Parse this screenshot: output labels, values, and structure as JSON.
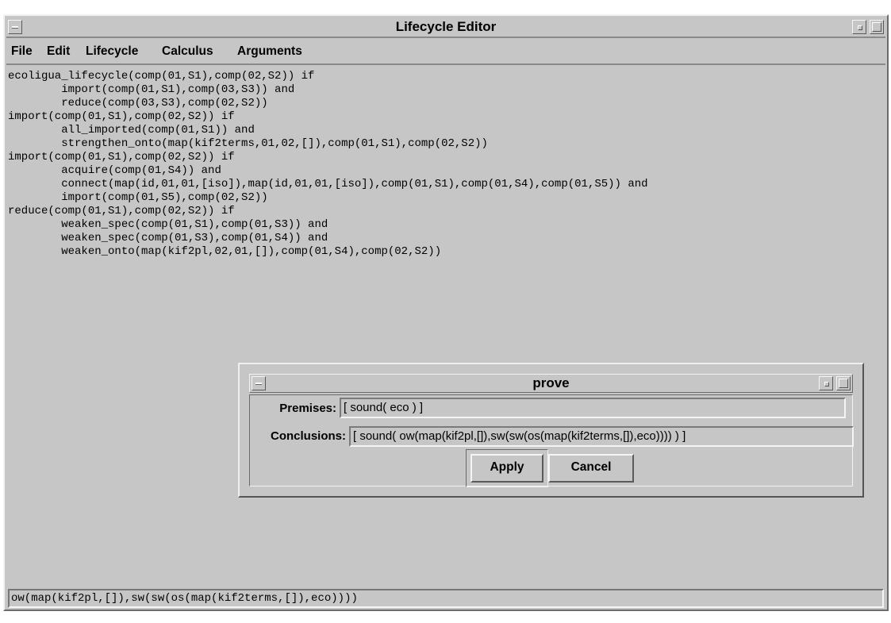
{
  "window": {
    "title": "Lifecycle Editor"
  },
  "menubar": {
    "items": [
      "File",
      "Edit",
      "Lifecycle",
      "Calculus",
      "Arguments"
    ]
  },
  "editor": {
    "code": "ecoligua_lifecycle(comp(01,S1),comp(02,S2)) if\n        import(comp(01,S1),comp(03,S3)) and\n        reduce(comp(03,S3),comp(02,S2))\nimport(comp(01,S1),comp(02,S2)) if\n        all_imported(comp(01,S1)) and\n        strengthen_onto(map(kif2terms,01,02,[]),comp(01,S1),comp(02,S2))\nimport(comp(01,S1),comp(02,S2)) if\n        acquire(comp(01,S4)) and\n        connect(map(id,01,01,[iso]),map(id,01,01,[iso]),comp(01,S1),comp(01,S4),comp(01,S5)) and\n        import(comp(01,S5),comp(02,S2))\nreduce(comp(01,S1),comp(02,S2)) if\n        weaken_spec(comp(01,S1),comp(01,S3)) and\n        weaken_spec(comp(01,S3),comp(01,S4)) and\n        weaken_onto(map(kif2pl,02,01,[]),comp(01,S4),comp(02,S2))"
  },
  "status": {
    "text": "ow(map(kif2pl,[]),sw(sw(os(map(kif2terms,[]),eco))))"
  },
  "dialog": {
    "title": "prove",
    "premises_label": "Premises:",
    "premises_value": "[ sound( eco ) ]",
    "conclusions_label": "Conclusions:",
    "conclusions_value": "[ sound( ow(map(kif2pl,[]),sw(sw(os(map(kif2terms,[]),eco)))) ) ]",
    "apply_label": "Apply",
    "cancel_label": "Cancel"
  }
}
